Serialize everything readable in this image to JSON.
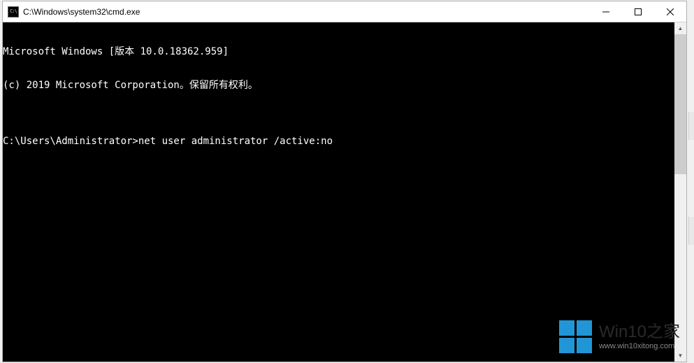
{
  "window": {
    "title": "C:\\Windows\\system32\\cmd.exe",
    "icon_label": "cmd-icon"
  },
  "controls": {
    "minimize": "—",
    "maximize": "☐",
    "close": "✕"
  },
  "terminal": {
    "lines": [
      "Microsoft Windows [版本 10.0.18362.959]",
      "(c) 2019 Microsoft Corporation。保留所有权利。",
      "",
      "C:\\Users\\Administrator>net user administrator /active:no"
    ],
    "prompt": "C:\\Users\\Administrator>",
    "command": "net user administrator /active:no"
  },
  "watermark": {
    "title": "Win10之家",
    "url": "www.win10xitong.com"
  }
}
